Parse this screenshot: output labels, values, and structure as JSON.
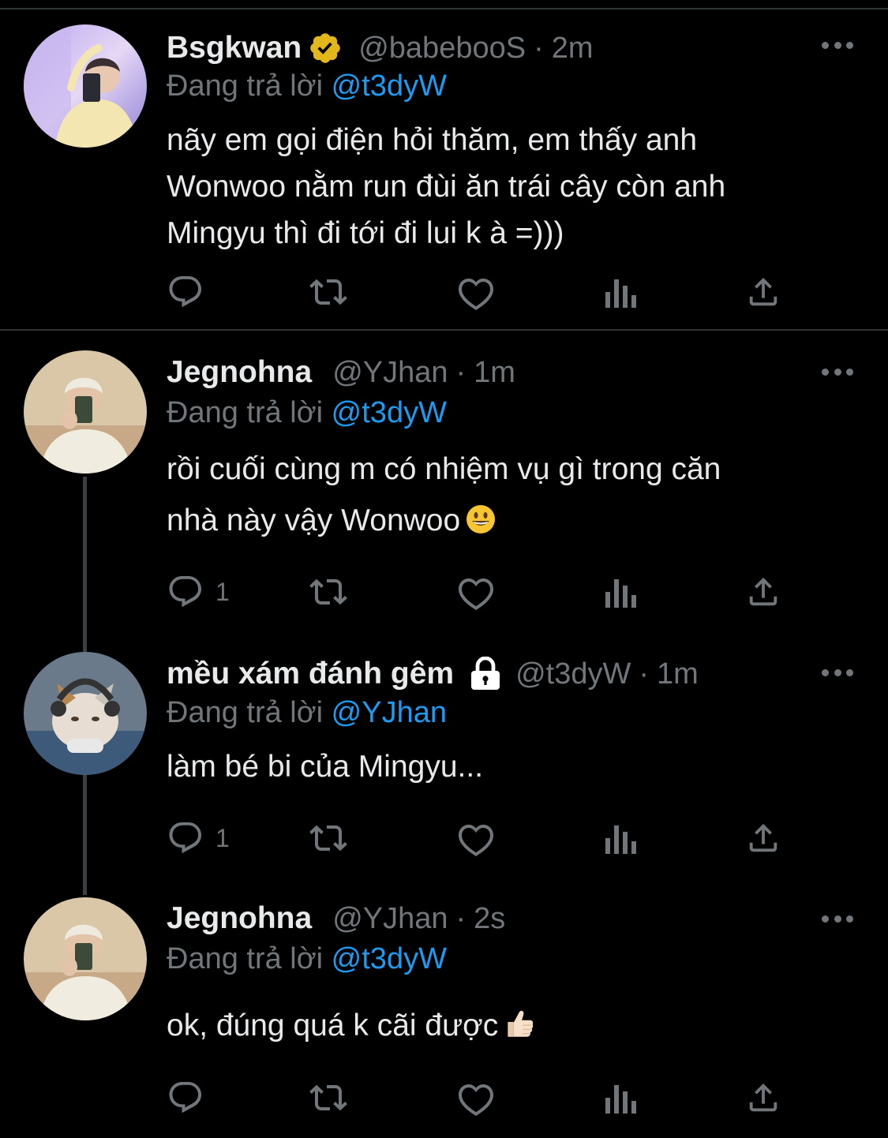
{
  "reply_prefix": "Đang trả lời",
  "tweets": [
    {
      "display_name": "Bsgkwan",
      "handle": "@babebooS",
      "separator": "·",
      "time": "2m",
      "replying_to": "@t3dyW",
      "text_lines": [
        "nãy em gọi điện hỏi thăm, em thấy anh",
        "Wonwoo nằm run đùi ăn trái cây còn anh",
        "Mingyu thì đi tới đi lui k à =)))"
      ],
      "reply_count": "",
      "verified": true
    },
    {
      "display_name": "Jegnohna",
      "handle": "@YJhan",
      "separator": "·",
      "time": "1m",
      "replying_to": "@t3dyW",
      "text_lines": [
        "rồi cuối cùng m có nhiệm vụ gì trong căn",
        "nhà này vậy Wonwoo"
      ],
      "emoji": "smiley-emoji",
      "reply_count": "1"
    },
    {
      "display_name": "mều xám đánh gêm",
      "handle": "@t3dyW",
      "separator": "·",
      "time": "1m",
      "replying_to": "@YJhan",
      "text_lines": [
        "làm bé bi của Mingyu..."
      ],
      "reply_count": "1",
      "protected": true
    },
    {
      "display_name": "Jegnohna",
      "handle": "@YJhan",
      "separator": "·",
      "time": "2s",
      "replying_to": "@t3dyW",
      "text_lines": [
        "ok, đúng quá k cãi được"
      ],
      "emoji": "thumbs-up-emoji",
      "reply_count": ""
    }
  ],
  "colors": {
    "background": "#000000",
    "text": "#e7e9ea",
    "secondary": "#71767b",
    "link": "#1d9bf0",
    "verified_badge": "#e2b719",
    "divider": "#2f3336"
  }
}
